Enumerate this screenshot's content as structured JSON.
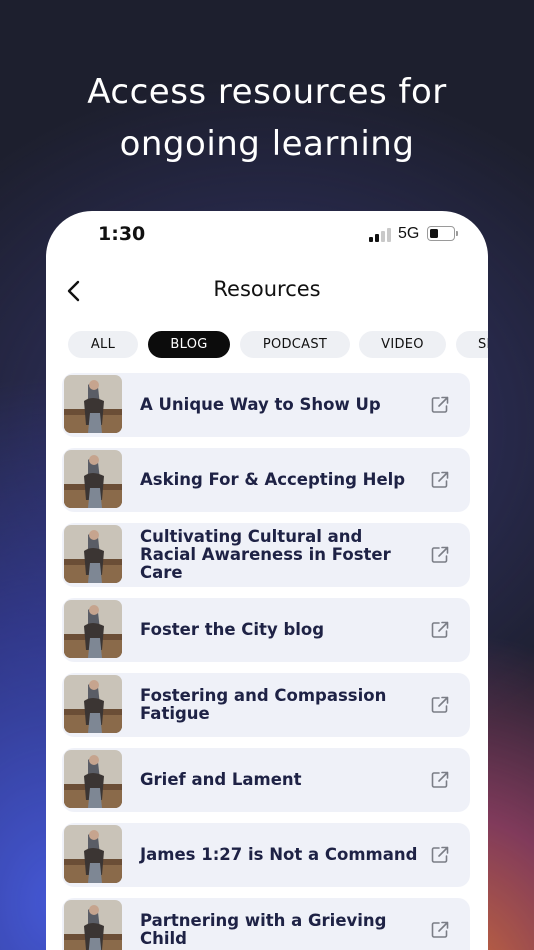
{
  "headline": {
    "line1": "Access resources for",
    "line2": "ongoing learning"
  },
  "status_bar": {
    "time": "1:30",
    "network": "5G"
  },
  "nav": {
    "title": "Resources",
    "back_icon": "chevron-left-icon"
  },
  "filters": {
    "selected": "BLOG",
    "chips": [
      {
        "label": "ALL"
      },
      {
        "label": "BLOG"
      },
      {
        "label": "PODCAST"
      },
      {
        "label": "VIDEO"
      },
      {
        "label": "SI"
      }
    ]
  },
  "resources": [
    {
      "title": "A Unique Way to Show Up"
    },
    {
      "title": "Asking For & Accepting Help"
    },
    {
      "title": "Cultivating Cultural and Racial Awareness in Foster Care"
    },
    {
      "title": "Foster the City blog"
    },
    {
      "title": "Fostering and Compassion Fatigue"
    },
    {
      "title": "Grief and Lament"
    },
    {
      "title": "James 1:27 is Not a Command"
    },
    {
      "title": "Partnering with a Grieving Child"
    }
  ],
  "icons": {
    "row_thumbnail": "photo-thumbnail",
    "row_action": "external-link-icon"
  },
  "colors": {
    "accent_dark": "#0c0c0c",
    "row_bg": "#eff1f8",
    "title_text": "#1e2245",
    "chip_bg": "#eef0f4"
  }
}
